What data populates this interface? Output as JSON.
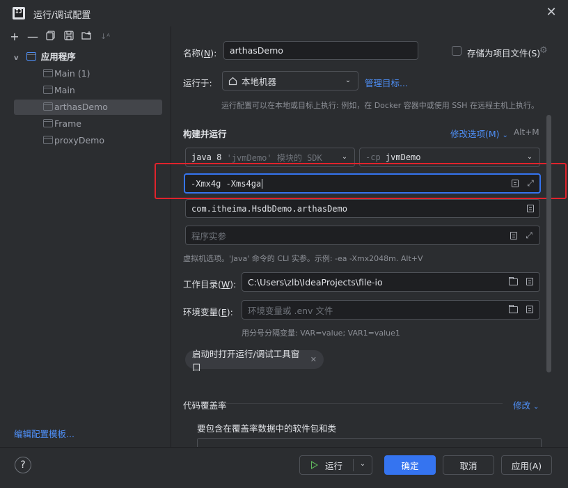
{
  "window": {
    "title": "运行/调试配置",
    "close_glyph": "✕"
  },
  "left_toolbar": {
    "icons": [
      "add-icon",
      "remove-icon",
      "copy-icon",
      "save-icon",
      "new-folder-icon",
      "sort-icon"
    ]
  },
  "tree": {
    "parent_label": "应用程序",
    "items": [
      {
        "label": "Main (1)",
        "selected": false
      },
      {
        "label": "Main",
        "selected": false
      },
      {
        "label": "arthasDemo",
        "selected": true
      },
      {
        "label": "Frame",
        "selected": false
      },
      {
        "label": "proxyDemo",
        "selected": false
      }
    ],
    "edit_templates_link": "编辑配置模板..."
  },
  "form": {
    "name_label": "名称(",
    "name_mnemonic": "N",
    "name_label_end": "):",
    "name_value": "arthasDemo",
    "store_as_project_file_label": "存储为项目文件(S)",
    "store_as_project_file_checked": false,
    "run_on_label": "运行于:",
    "run_on_value": "本地机器",
    "manage_targets_link": "管理目标...",
    "run_on_hint": "运行配置可以在本地或目标上执行: 例如，在 Docker 容器中或使用 SSH 在远程主机上执行。",
    "build_and_run_title": "构建并运行",
    "modify_options_link": "修改选项(M)",
    "modify_options_shortcut": "Alt+M",
    "sdk_value_main": "java 8",
    "sdk_value_detail": "'jvmDemo' 模块的 SDK",
    "classpath_prefix": "-cp",
    "classpath_value": "jvmDemo",
    "vm_options_value": "-Xmx4g -Xms4ga",
    "main_class_value": "com.itheima.HsdbDemo.arthasDemo",
    "program_args_placeholder": "程序实参",
    "vm_hint": "虚拟机选项。'Java' 命令的 CLI 实参。示例: -ea -Xmx2048m. Alt+V",
    "working_dir_label": "工作目录(",
    "working_dir_mnemonic": "W",
    "working_dir_label_end": "):",
    "working_dir_value": "C:\\Users\\zlb\\IdeaProjects\\file-io",
    "env_label": "环境变量(",
    "env_mnemonic": "E",
    "env_label_end": "):",
    "env_placeholder": "环境变量或 .env 文件",
    "env_hint": "用分号分隔变量: VAR=value; VAR1=value1",
    "open_tool_window_chip": "启动时打开运行/调试工具窗口",
    "coverage_title": "代码覆盖率",
    "coverage_modify_link": "修改",
    "coverage_subtitle": "要包含在覆盖率数据中的软件包和类"
  },
  "buttons": {
    "help": "?",
    "run": "运行",
    "ok": "确定",
    "cancel": "取消",
    "apply": "应用(A)"
  },
  "colors": {
    "accent": "#3574f0",
    "link": "#4e8ff7",
    "highlight_box": "#e0232c",
    "run_icon": "#5fb85c"
  }
}
